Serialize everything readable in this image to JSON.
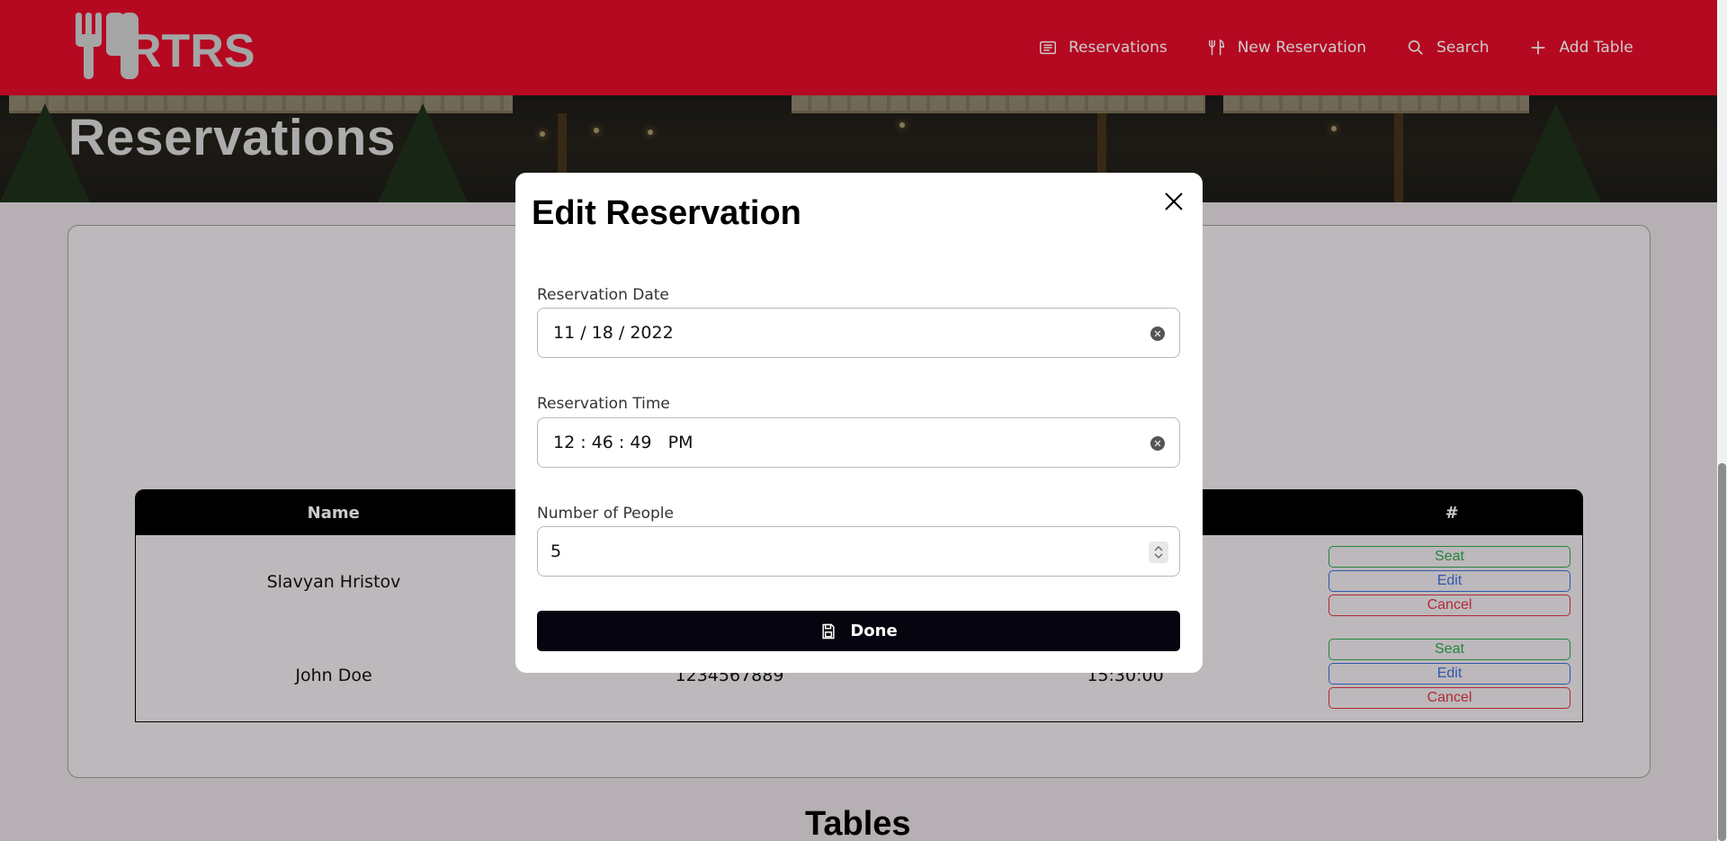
{
  "app": {
    "logo_text": "RTRS"
  },
  "nav": {
    "items": [
      {
        "label": "Reservations",
        "icon": "list-icon"
      },
      {
        "label": "New Reservation",
        "icon": "utensils-icon"
      },
      {
        "label": "Search",
        "icon": "search-icon"
      },
      {
        "label": "Add Table",
        "icon": "plus-icon"
      }
    ]
  },
  "hero": {
    "title": "Reservations"
  },
  "reservations_table": {
    "columns": [
      "Name",
      "",
      "",
      "#"
    ],
    "rows": [
      {
        "name": "Slavyan Hristov",
        "phone": "",
        "time": ""
      },
      {
        "name": "John Doe",
        "phone": "1234567889",
        "time": "15:30:00"
      }
    ],
    "action_labels": {
      "seat": "Seat",
      "edit": "Edit",
      "cancel": "Cancel"
    }
  },
  "tables_section": {
    "title": "Tables"
  },
  "modal": {
    "title": "Edit Reservation",
    "fields": {
      "date": {
        "label": "Reservation Date",
        "value": "11 / 18 / 2022"
      },
      "time": {
        "label": "Reservation Time",
        "value": "12 : 46 : 49   PM"
      },
      "people": {
        "label": "Number of People",
        "value": "5"
      }
    },
    "done_label": "Done"
  },
  "colors": {
    "navbar": "#e30b2a",
    "primary_dark": "#06050f",
    "seat": "#2ea44f",
    "edit": "#3d6fd8",
    "cancel": "#dc3545"
  }
}
